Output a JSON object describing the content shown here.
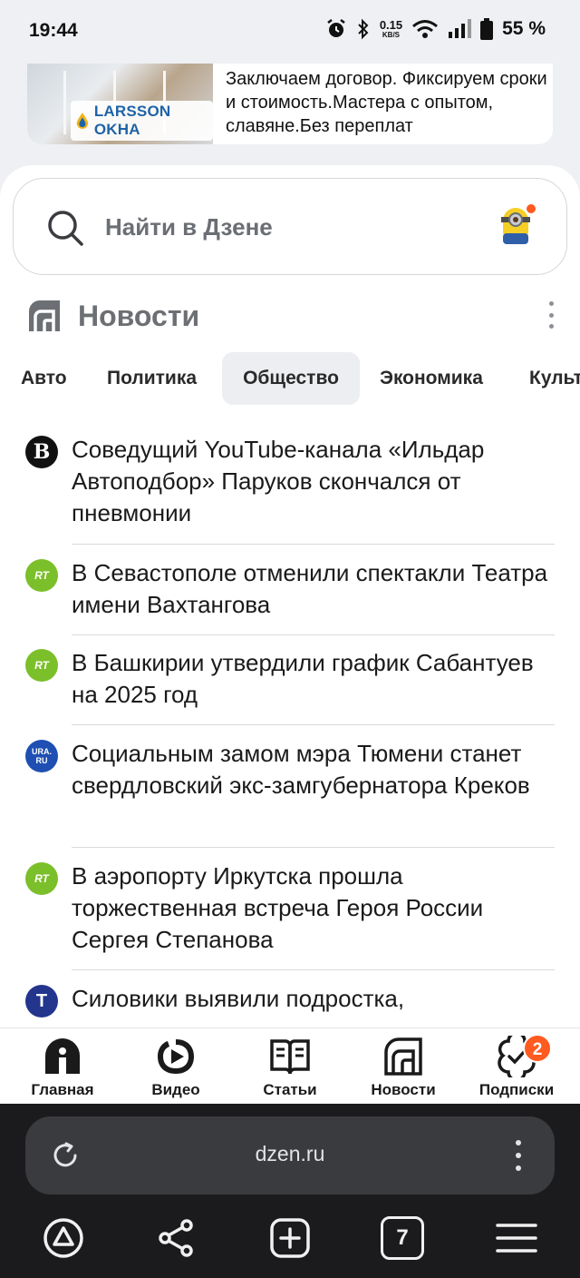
{
  "status": {
    "time": "19:44",
    "net_speed": "0.15",
    "net_unit": "KB/S",
    "battery": "55 %"
  },
  "ad": {
    "brand": "LARSSON OKHA",
    "text": "Заключаем договор. Фиксируем сроки и стоимость.Мастера с опытом, славяне.Без переплат"
  },
  "search": {
    "placeholder": "Найти в Дзене"
  },
  "news": {
    "title": "Новости",
    "tabs": [
      "Авто",
      "Политика",
      "Общество",
      "Экономика",
      "Культура"
    ],
    "active_tab": "Общество",
    "items": [
      {
        "source": "bell",
        "headline": "Соведущий YouTube-канала «Ильдар Автоподбор» Паруков скончался от пневмонии"
      },
      {
        "source": "rt",
        "headline": "В Севастополе отменили спектакли Театра имени Вахтангова"
      },
      {
        "source": "rt",
        "headline": "В Башкирии утвердили график Сабантуев на 2025 год"
      },
      {
        "source": "ura",
        "headline": "Социальным замом мэра Тюмени станет свердловский экс-замгубернатора Креков"
      },
      {
        "source": "rt",
        "headline": "В аэропорту Иркутска прошла торжественная встреча Героя России Сергея Степанова"
      },
      {
        "source": "t",
        "headline": "Силовики выявили подростка,"
      }
    ],
    "source_badges": {
      "bell": "B",
      "rt": "RT",
      "ura_top": "URA.",
      "ura_bottom": "RU",
      "t": "T"
    }
  },
  "bottom_nav": {
    "items": [
      {
        "label": "Главная",
        "icon": "home-icon"
      },
      {
        "label": "Видео",
        "icon": "play-icon"
      },
      {
        "label": "Статьи",
        "icon": "book-icon"
      },
      {
        "label": "Новости",
        "icon": "news-icon"
      },
      {
        "label": "Подписки",
        "icon": "subscriptions-icon"
      }
    ],
    "subscriptions_badge": "2"
  },
  "browser": {
    "url": "dzen.ru",
    "tabs_count": "7"
  },
  "colors": {
    "accent": "#ff5a1f",
    "rt_green": "#7bbf2a",
    "browser_bg": "#1b1b1d"
  }
}
